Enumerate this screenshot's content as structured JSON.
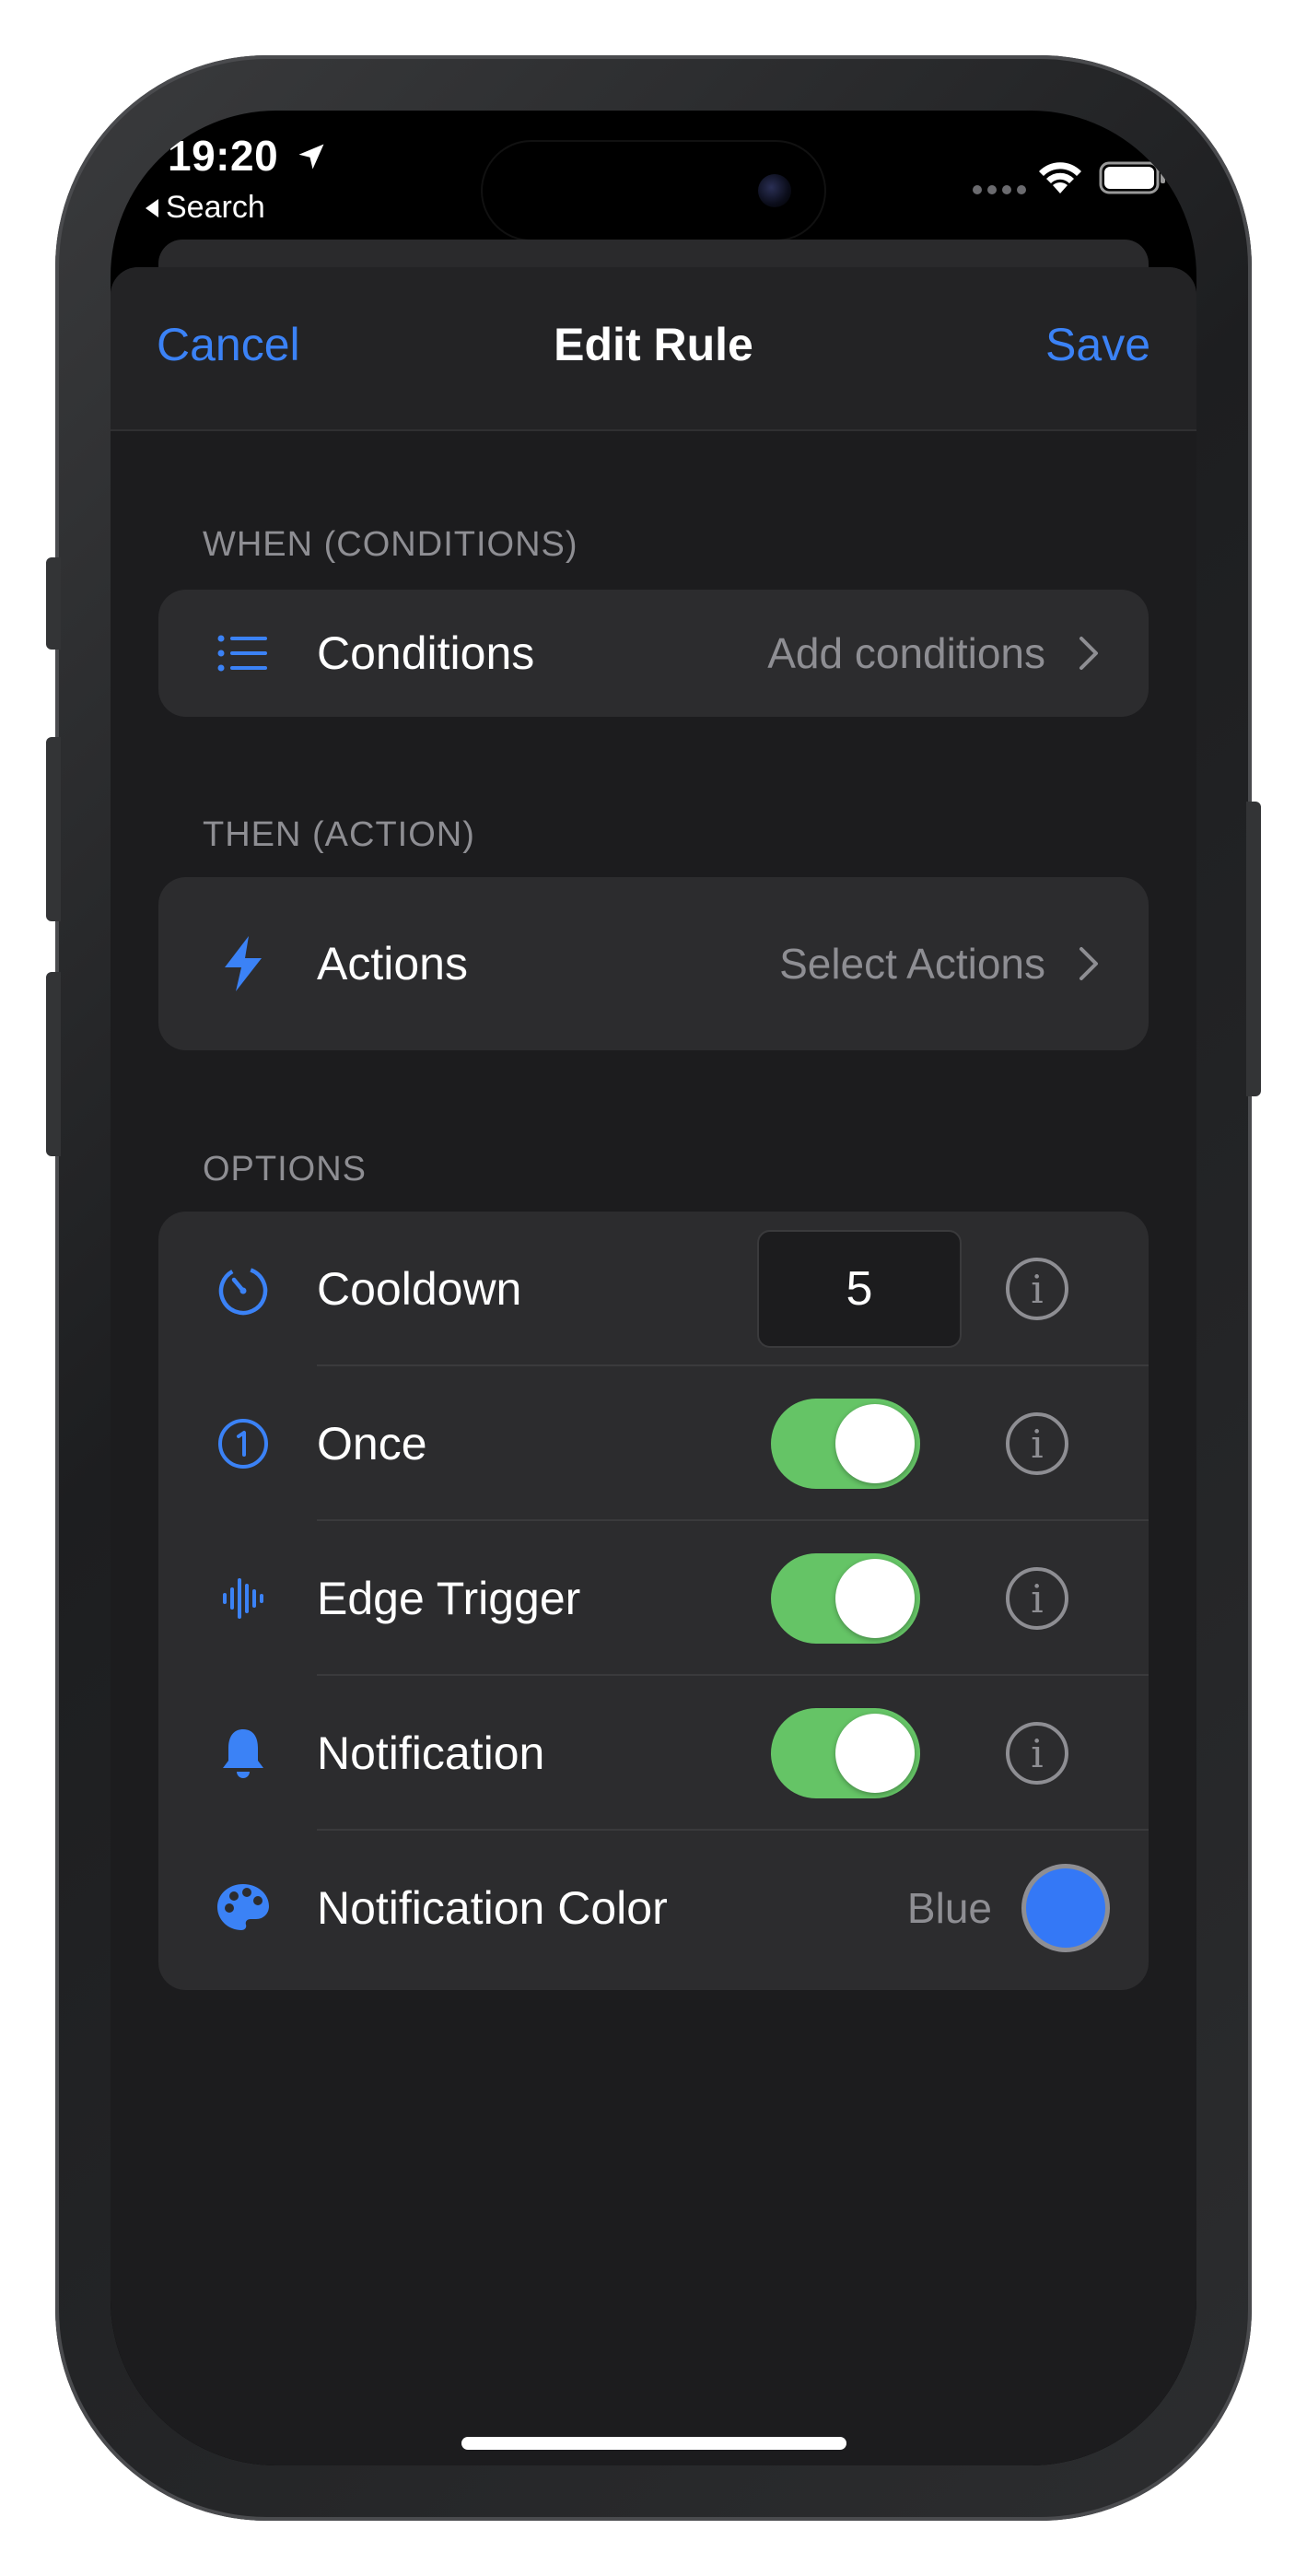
{
  "status_bar": {
    "time": "19:20",
    "back_label": "Search"
  },
  "nav": {
    "cancel_label": "Cancel",
    "title": "Edit Rule",
    "save_label": "Save"
  },
  "sections": {
    "conditions_header": "WHEN (CONDITIONS)",
    "actions_header": "THEN (ACTION)",
    "options_header": "OPTIONS"
  },
  "conditions": {
    "label": "Conditions",
    "value": "Add conditions",
    "icon": "list-icon"
  },
  "actions": {
    "label": "Actions",
    "value": "Select Actions",
    "icon": "bolt-icon"
  },
  "options": {
    "cooldown": {
      "label": "Cooldown",
      "value": "5",
      "icon": "timer-icon"
    },
    "once": {
      "label": "Once",
      "enabled": true,
      "icon": "number-one-circle-icon"
    },
    "edge_trigger": {
      "label": "Edge Trigger",
      "enabled": true,
      "icon": "waveform-icon"
    },
    "notification": {
      "label": "Notification",
      "enabled": true,
      "icon": "bell-icon"
    },
    "notification_color": {
      "label": "Notification Color",
      "value": "Blue",
      "icon": "palette-icon",
      "swatch_color": "#3478f6"
    }
  },
  "colors": {
    "accent": "#3b82f6",
    "toggle_on": "#65c466",
    "secondary_text": "#8e8e93"
  }
}
